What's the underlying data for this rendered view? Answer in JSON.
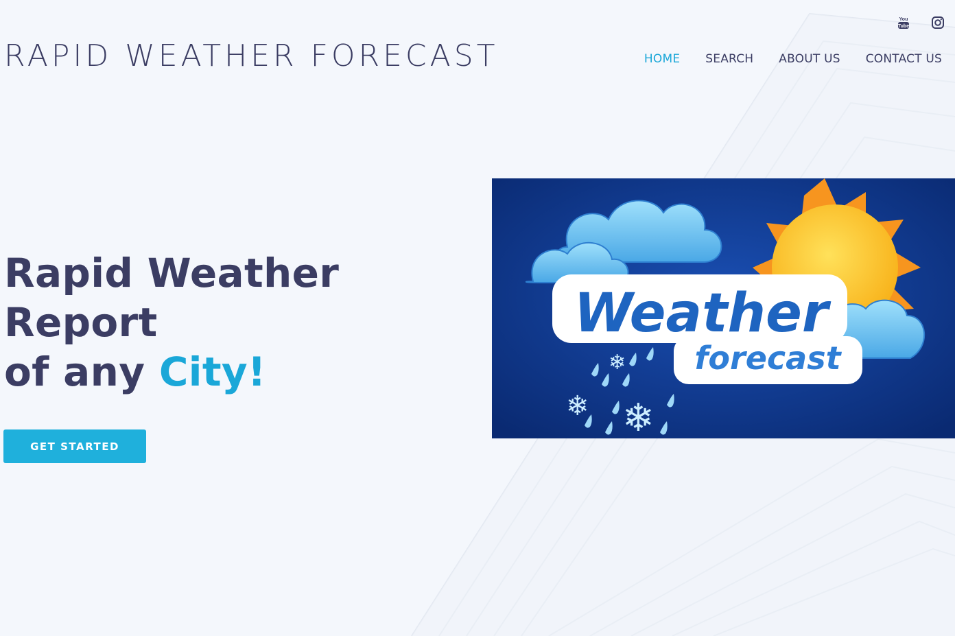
{
  "brand": {
    "title": "RAPID WEATHER FORECAST"
  },
  "social": {
    "youtube_icon": "youtube-icon",
    "instagram_icon": "instagram-icon"
  },
  "nav": {
    "items": [
      {
        "label": "HOME",
        "active": true
      },
      {
        "label": "SEARCH",
        "active": false
      },
      {
        "label": "ABOUT US",
        "active": false
      },
      {
        "label": "CONTACT US",
        "active": false
      }
    ]
  },
  "hero": {
    "line1": "Rapid Weather",
    "line2": "Report",
    "line3_prefix": "of any ",
    "line3_accent": "City!",
    "cta_label": "GET STARTED",
    "image_text_main": "Weather",
    "image_text_sub": "forecast"
  },
  "colors": {
    "accent": "#1aa7d8",
    "text": "#3b3d63",
    "background": "#f4f7fc",
    "button": "#1fb0dc",
    "image_bg": "#0c2f7e"
  }
}
